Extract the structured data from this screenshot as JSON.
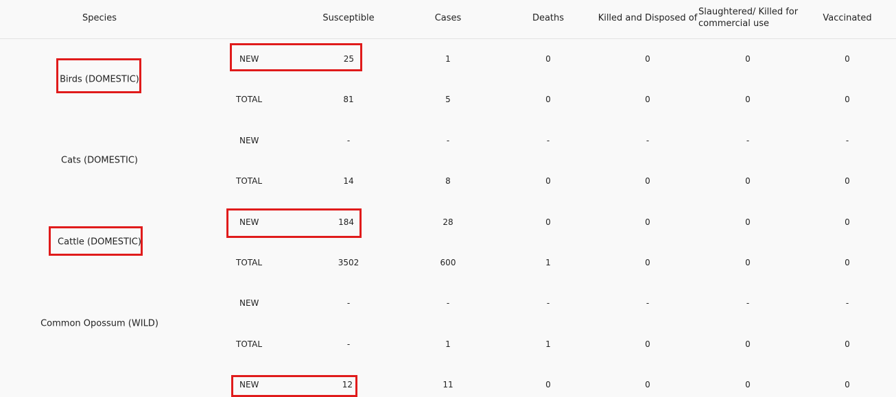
{
  "headers": {
    "species": "Species",
    "susceptible": "Susceptible",
    "cases": "Cases",
    "deaths": "Deaths",
    "killed": "Killed and Disposed of",
    "slaughtered": "Slaughtered/ Killed for commercial use",
    "vaccinated": "Vaccinated"
  },
  "rows": [
    {
      "species": "Birds (DOMESTIC)",
      "new": {
        "label": "NEW",
        "susceptible": "25",
        "cases": "1",
        "deaths": "0",
        "killed": "0",
        "slaughtered": "0",
        "vaccinated": "0"
      },
      "total": {
        "label": "TOTAL",
        "susceptible": "81",
        "cases": "5",
        "deaths": "0",
        "killed": "0",
        "slaughtered": "0",
        "vaccinated": "0"
      }
    },
    {
      "species": "Cats (DOMESTIC)",
      "new": {
        "label": "NEW",
        "susceptible": "-",
        "cases": "-",
        "deaths": "-",
        "killed": "-",
        "slaughtered": "-",
        "vaccinated": "-"
      },
      "total": {
        "label": "TOTAL",
        "susceptible": "14",
        "cases": "8",
        "deaths": "0",
        "killed": "0",
        "slaughtered": "0",
        "vaccinated": "0"
      }
    },
    {
      "species": "Cattle (DOMESTIC)",
      "new": {
        "label": "NEW",
        "susceptible": "184",
        "cases": "28",
        "deaths": "0",
        "killed": "0",
        "slaughtered": "0",
        "vaccinated": "0"
      },
      "total": {
        "label": "TOTAL",
        "susceptible": "3502",
        "cases": "600",
        "deaths": "1",
        "killed": "0",
        "slaughtered": "0",
        "vaccinated": "0"
      }
    },
    {
      "species": "Common Opossum (WILD)",
      "new": {
        "label": "NEW",
        "susceptible": "-",
        "cases": "-",
        "deaths": "-",
        "killed": "-",
        "slaughtered": "-",
        "vaccinated": "-"
      },
      "total": {
        "label": "TOTAL",
        "susceptible": "-",
        "cases": "1",
        "deaths": "1",
        "killed": "0",
        "slaughtered": "0",
        "vaccinated": "0"
      }
    },
    {
      "species": "",
      "new": {
        "label": "NEW",
        "susceptible": "12",
        "cases": "11",
        "deaths": "0",
        "killed": "0",
        "slaughtered": "0",
        "vaccinated": "0"
      }
    }
  ],
  "highlight_color": "#e01b1b"
}
